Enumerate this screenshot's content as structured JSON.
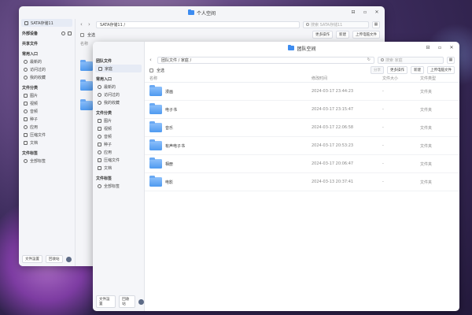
{
  "back_window": {
    "title": "个人空间",
    "controls": [
      "⊟",
      "▫",
      "✕"
    ],
    "path": "SATA存储11 /",
    "search_placeholder": "搜索 SATA存储11",
    "toolbar": {
      "select_all": "全选",
      "view_col": "名称",
      "more": "更多操作",
      "new": "新建",
      "upload": "上传电脑文件"
    },
    "sidebar": {
      "selected": "SATA存储11",
      "external": "外部设备",
      "shared": "共享文件",
      "common_head": "常用入口",
      "common": [
        "最新的",
        "访问过的",
        "我的收藏"
      ],
      "category_head": "文件分类",
      "categories": [
        "图片",
        "视频",
        "音频",
        "种子",
        "应用",
        "压缩文件",
        "文档"
      ],
      "tag_head": "文件标签",
      "tags": [
        "全部标签"
      ],
      "bottom": [
        "文件設置",
        "回收站"
      ]
    }
  },
  "front_window": {
    "title": "团队空间",
    "controls": [
      "⊟",
      "▫",
      "✕"
    ],
    "path": "团队文件 / 家庭 /",
    "search_placeholder": "搜索 家庭",
    "toolbar": {
      "select_all": "全选",
      "share": "分享",
      "more": "更多操作",
      "new": "新建",
      "upload": "上传电脑文件"
    },
    "columns": {
      "name": "名称",
      "date": "修改时间",
      "size": "文件大小",
      "type": "文件类型"
    },
    "rows": [
      {
        "name": "漫画",
        "date": "2024-03-17 23:44:23",
        "size": "-",
        "type": "文件夹"
      },
      {
        "name": "电子书",
        "date": "2024-03-17 23:15:47",
        "size": "-",
        "type": "文件夹"
      },
      {
        "name": "音乐",
        "date": "2024-03-17 22:06:58",
        "size": "-",
        "type": "文件夹"
      },
      {
        "name": "有声电子书",
        "date": "2024-03-17 20:53:23",
        "size": "-",
        "type": "文件夹"
      },
      {
        "name": "相册",
        "date": "2024-03-17 20:06:47",
        "size": "-",
        "type": "文件夹"
      },
      {
        "name": "电影",
        "date": "2024-03-13 20:37:41",
        "size": "-",
        "type": "文件夹"
      }
    ],
    "sidebar": {
      "team_head": "团队文件",
      "selected": "家庭",
      "common_head": "常用入口",
      "common": [
        "最新的",
        "访问过的",
        "我的收藏"
      ],
      "category_head": "文件分类",
      "categories": [
        "图片",
        "视频",
        "音频",
        "种子",
        "应用",
        "压缩文件",
        "文档"
      ],
      "tag_head": "文件标签",
      "tags": [
        "全部标签"
      ],
      "bottom": [
        "文件設置",
        "回收站"
      ]
    }
  }
}
